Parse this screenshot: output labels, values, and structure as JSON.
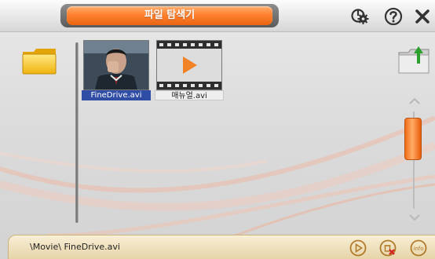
{
  "header": {
    "title": "파일 탐색기",
    "buttons": [
      {
        "name": "settings-gear-icon"
      },
      {
        "name": "help-icon"
      },
      {
        "name": "close-icon"
      }
    ]
  },
  "files": [
    {
      "name": "FineDrive.avi",
      "selected": true,
      "thumbnail": "video-frame"
    },
    {
      "name": "매뉴얼.avi",
      "selected": false,
      "thumbnail": "film-play-icon"
    }
  ],
  "status_bar": {
    "path": "\\Movie\\ FineDrive.avi",
    "buttons": [
      {
        "name": "play-icon"
      },
      {
        "name": "delete-icon"
      },
      {
        "name": "info-icon",
        "label": "info"
      }
    ]
  },
  "colors": {
    "accent": "#ff8230",
    "selection": "#2f4da5",
    "status_bar": "#ecdcb5"
  }
}
